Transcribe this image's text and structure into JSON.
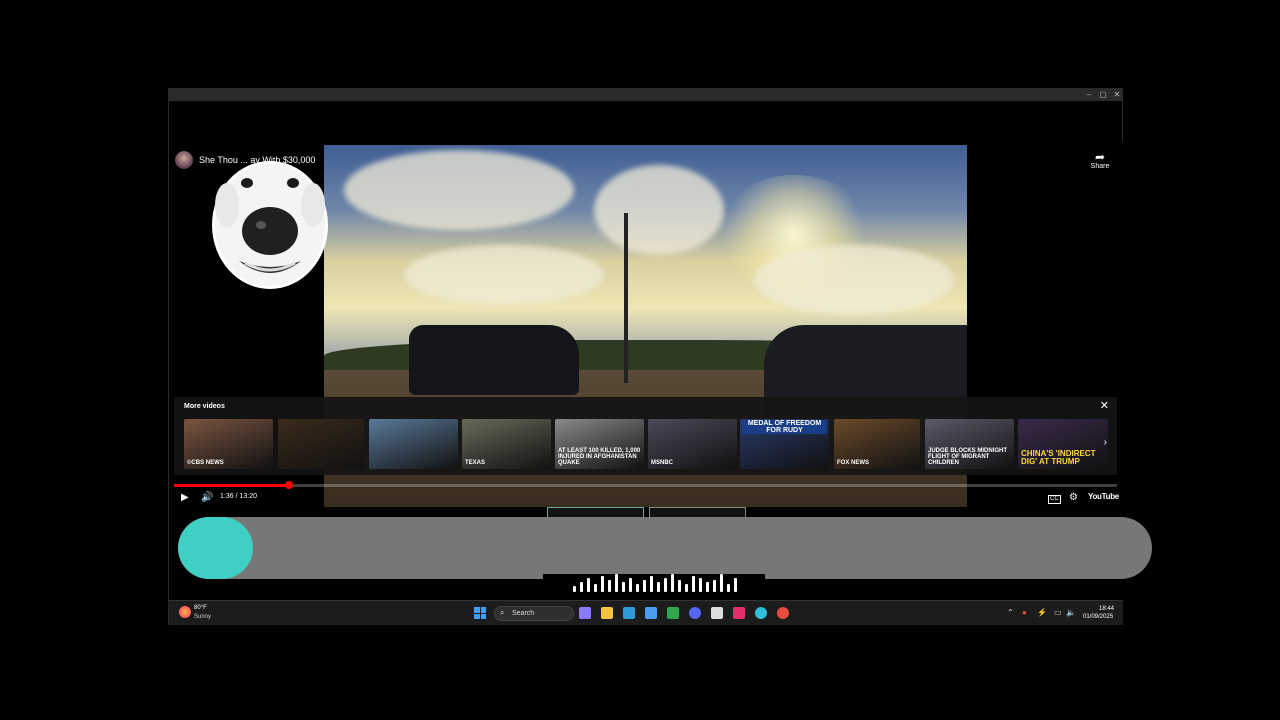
{
  "window": {
    "minimize_glyph": "–",
    "maximize_glyph": "▢",
    "close_glyph": "✕"
  },
  "player": {
    "video_title": "She Thou ... ay With $30,000",
    "share_label": "Share",
    "share_icon": "share-arrow-icon",
    "more_videos_title": "More videos",
    "close_glyph": "✕",
    "next_glyph": "›",
    "thumbnails": [
      {
        "caption": "©CBS NEWS",
        "style": "plain",
        "bg": "#7a5540"
      },
      {
        "caption": "",
        "style": "plain",
        "bg": "#3a2a1a"
      },
      {
        "caption": "",
        "style": "plain",
        "bg": "#5a7a9a"
      },
      {
        "caption": "TEXAS",
        "style": "plain",
        "bg": "#6a6a5a"
      },
      {
        "caption": "AT LEAST 100 KILLED, 1,000 INJURED IN AFGHANISTAN QUAKE",
        "style": "plain",
        "bg": "#8a8a8a"
      },
      {
        "caption": "MSNBC",
        "style": "plain",
        "bg": "#4a4a5a"
      },
      {
        "caption": "",
        "style": "top",
        "topcap": "MEDAL OF FREEDOM FOR RUDY",
        "bg": "#2a3a6a"
      },
      {
        "caption": "FOX NEWS",
        "style": "plain",
        "bg": "#6a4a2a"
      },
      {
        "caption": "JUDGE BLOCKS MIDNIGHT FLIGHT OF MIGRANT CHILDREN",
        "style": "plain",
        "bg": "#5a5a6a"
      },
      {
        "caption": "CHINA'S 'INDIRECT DIG' AT TRUMP",
        "style": "yellow",
        "bg": "#3a2a4a"
      }
    ],
    "progress_fraction": 0.122,
    "time_current": "1:36",
    "time_total": "13:20",
    "time_display": "1:36 / 13:20",
    "play_glyph": "▶",
    "volume_glyph": "🔊",
    "cc_glyph": "CC",
    "settings_glyph": "⚙",
    "logo_text": "YouTube"
  },
  "overlay": {
    "bar_color": "#777777",
    "dot_color": "#3fcfc4"
  },
  "taskbar": {
    "weather_temp": "80°F",
    "weather_condition": "Sunny",
    "search_label": "Search",
    "search_glyph": "⌕",
    "clock_time": "18:44",
    "clock_date": "01/09/2025",
    "tray_chevron": "⌃",
    "apps": [
      {
        "name": "copilot-icon",
        "color": "#8a7aff"
      },
      {
        "name": "file-explorer-icon",
        "color": "#f5c542"
      },
      {
        "name": "edge-icon",
        "color": "#2f9bd6"
      },
      {
        "name": "store-icon",
        "color": "#4a9ef0"
      },
      {
        "name": "xbox-icon",
        "color": "#2fa84f"
      },
      {
        "name": "discord-icon",
        "color": "#5865f2"
      },
      {
        "name": "qr-icon",
        "color": "#dddddd"
      },
      {
        "name": "instagram-icon",
        "color": "#e1306c"
      },
      {
        "name": "browser-icon",
        "color": "#2fbfd6"
      },
      {
        "name": "chrome-icon",
        "color": "#e74c3c"
      }
    ]
  }
}
